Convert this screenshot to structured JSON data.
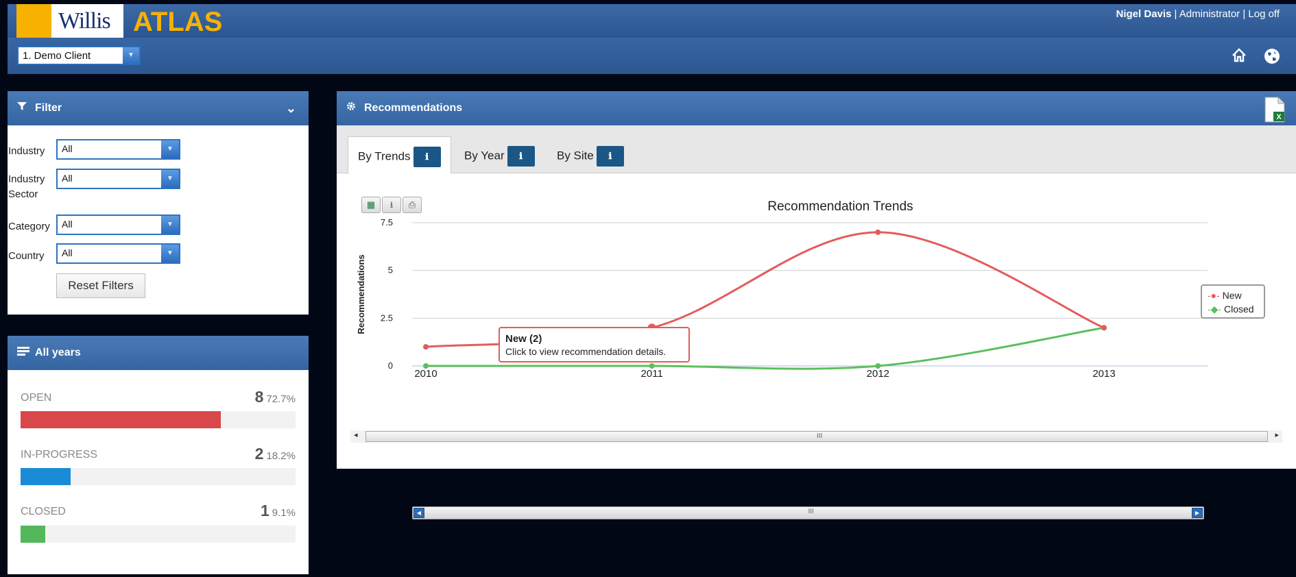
{
  "header": {
    "brand": "Willis",
    "app": "ATLAS",
    "user_name": "Nigel Davis",
    "role": "Administrator",
    "logoff": "Log off",
    "client_value": "1. Demo Client"
  },
  "filter": {
    "title": "Filter",
    "fields": [
      {
        "label": "Industry",
        "value": "All"
      },
      {
        "label": "Industry Sector",
        "value": "All"
      },
      {
        "label": "Category",
        "value": "All"
      },
      {
        "label": "Country",
        "value": "All"
      }
    ],
    "reset_label": "Reset Filters"
  },
  "years": {
    "title": "All years",
    "stats": [
      {
        "label": "OPEN",
        "count": "8",
        "pct": "72.7%",
        "fraction": 0.727,
        "color": "#d9474a"
      },
      {
        "label": "IN-PROGRESS",
        "count": "2",
        "pct": "18.2%",
        "fraction": 0.182,
        "color": "#1a8bd6"
      },
      {
        "label": "CLOSED",
        "count": "1",
        "pct": "9.1%",
        "fraction": 0.091,
        "color": "#52b85a"
      }
    ]
  },
  "recommendations": {
    "title": "Recommendations",
    "tabs": [
      {
        "label": "By Trends",
        "active": true
      },
      {
        "label": "By Year",
        "active": false
      },
      {
        "label": "By Site",
        "active": false
      }
    ],
    "tooltip": {
      "title": "New (2)",
      "text": "Click to view recommendation details."
    }
  },
  "chart_data": {
    "type": "line",
    "title": "Recommendation Trends",
    "xlabel": "",
    "ylabel": "Recommendations",
    "categories": [
      "2010",
      "2011",
      "2012",
      "2013"
    ],
    "yticks": [
      "0",
      "2.5",
      "5",
      "7.5"
    ],
    "ylim": [
      0,
      7.5
    ],
    "series": [
      {
        "name": "New",
        "values": [
          1,
          2,
          7,
          2
        ],
        "color": "#e35c5c"
      },
      {
        "name": "Closed",
        "values": [
          0,
          0,
          0,
          2
        ],
        "color": "#5cbf5c"
      }
    ],
    "legend": "right"
  }
}
